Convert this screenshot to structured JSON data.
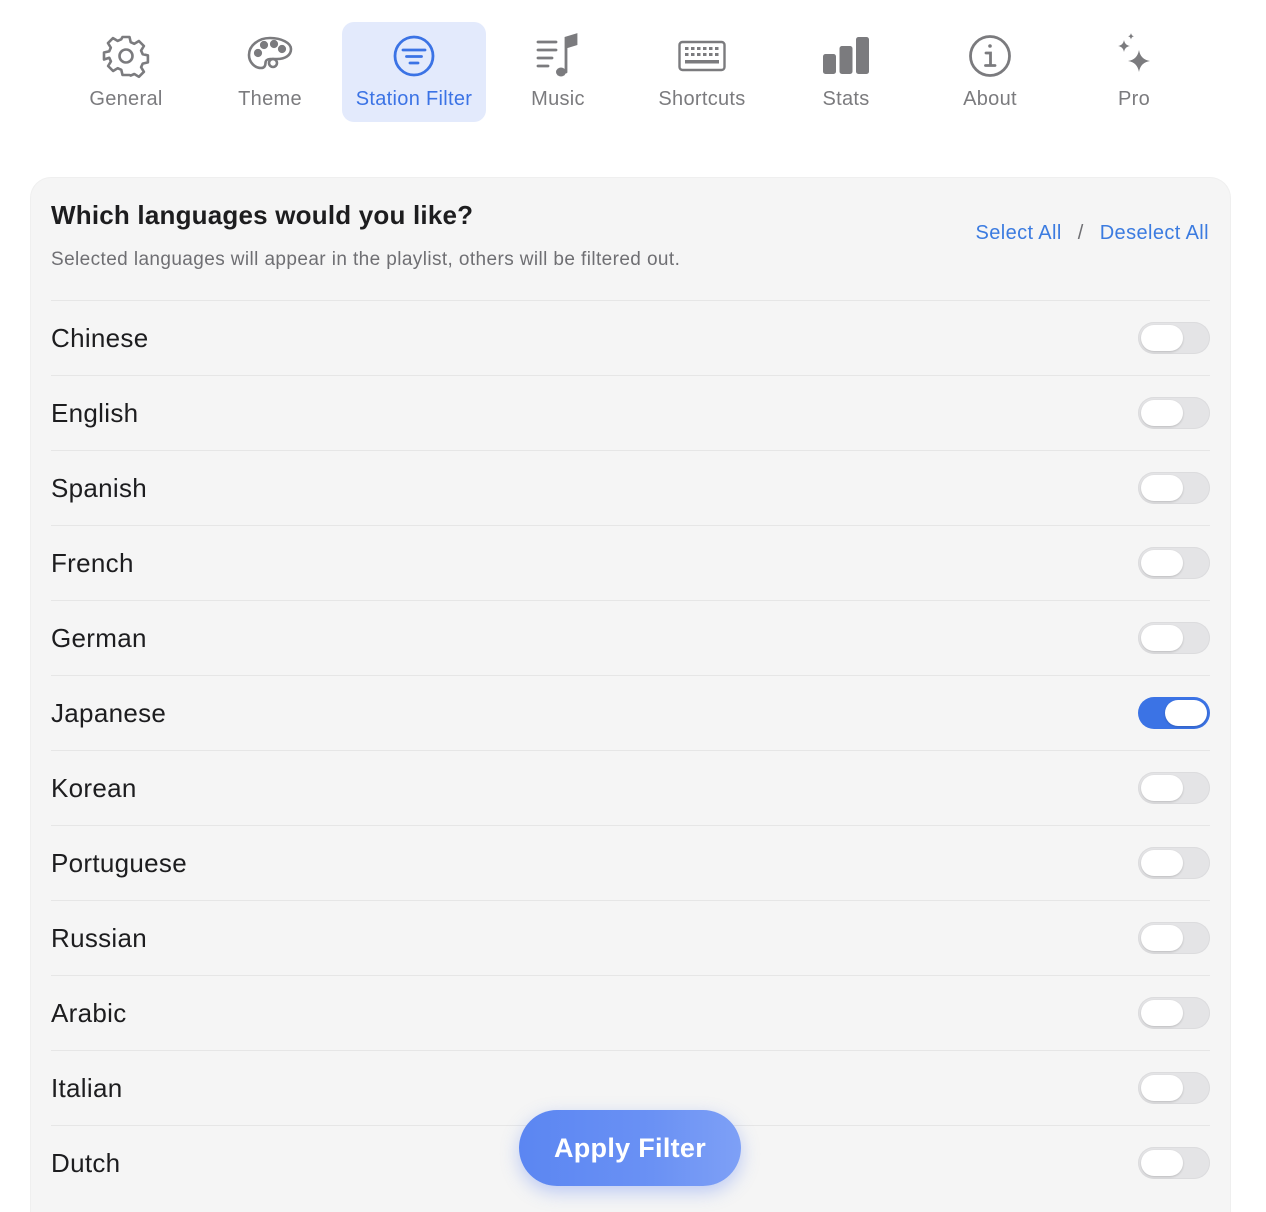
{
  "tabs": [
    {
      "label": "General",
      "icon": "gear-icon",
      "active": false
    },
    {
      "label": "Theme",
      "icon": "palette-icon",
      "active": false
    },
    {
      "label": "Station Filter",
      "icon": "filter-icon",
      "active": true
    },
    {
      "label": "Music",
      "icon": "music-list-icon",
      "active": false
    },
    {
      "label": "Shortcuts",
      "icon": "keyboard-icon",
      "active": false
    },
    {
      "label": "Stats",
      "icon": "bar-chart-icon",
      "active": false
    },
    {
      "label": "About",
      "icon": "info-icon",
      "active": false
    },
    {
      "label": "Pro",
      "icon": "sparkles-icon",
      "active": false
    }
  ],
  "section": {
    "title": "Which languages would you like?",
    "subtitle": "Selected languages will appear in the playlist, others will be filtered out.",
    "select_all": "Select All",
    "separator": "/",
    "deselect_all": "Deselect All"
  },
  "languages": [
    {
      "name": "Chinese",
      "enabled": false
    },
    {
      "name": "English",
      "enabled": false
    },
    {
      "name": "Spanish",
      "enabled": false
    },
    {
      "name": "French",
      "enabled": false
    },
    {
      "name": "German",
      "enabled": false
    },
    {
      "name": "Japanese",
      "enabled": true
    },
    {
      "name": "Korean",
      "enabled": false
    },
    {
      "name": "Portuguese",
      "enabled": false
    },
    {
      "name": "Russian",
      "enabled": false
    },
    {
      "name": "Arabic",
      "enabled": false
    },
    {
      "name": "Italian",
      "enabled": false
    },
    {
      "name": "Dutch",
      "enabled": false
    }
  ],
  "apply_button": "Apply Filter",
  "colors": {
    "accent": "#3b73e5",
    "active_tab_bg": "#e3eafc",
    "link": "#3b7be0",
    "icon_gray": "#7b7b7e"
  }
}
